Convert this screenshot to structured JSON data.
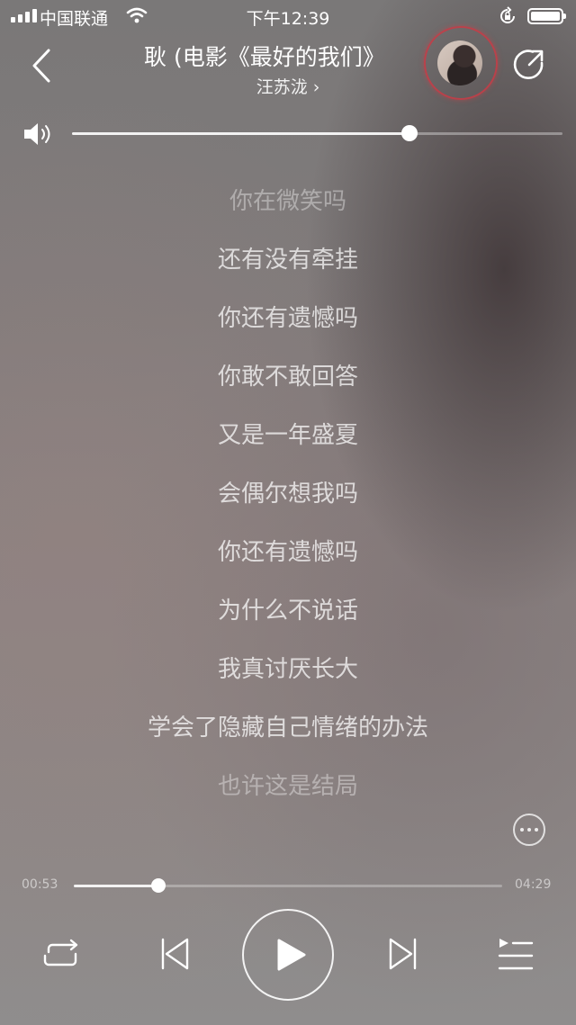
{
  "status_bar": {
    "carrier": "中国联通",
    "time": "下午12:39"
  },
  "header": {
    "title": "耿 (电影《最好的我们》",
    "artist": "汪苏泷",
    "artist_chevron": "›"
  },
  "volume": {
    "level": 0.688
  },
  "lyrics": [
    {
      "text": "你在微笑吗",
      "faded": true
    },
    {
      "text": "还有没有牵挂",
      "faded": false
    },
    {
      "text": "你还有遗憾吗",
      "faded": false
    },
    {
      "text": "你敢不敢回答",
      "faded": false
    },
    {
      "text": "又是一年盛夏",
      "faded": false
    },
    {
      "text": "会偶尔想我吗",
      "faded": false
    },
    {
      "text": "你还有遗憾吗",
      "faded": false
    },
    {
      "text": "为什么不说话",
      "faded": false
    },
    {
      "text": "我真讨厌长大",
      "faded": false
    },
    {
      "text": "学会了隐藏自己情绪的办法",
      "faded": false
    },
    {
      "text": "也许这是结局",
      "faded": true
    }
  ],
  "progress": {
    "current_time": "00:53",
    "total_time": "04:29",
    "fraction": 0.197
  },
  "controls": {
    "repeat": "repeat-icon",
    "previous": "previous-icon",
    "play": "play-icon",
    "next": "next-icon",
    "playlist": "playlist-icon"
  },
  "colors": {
    "accent_ring": "#c83c46",
    "text": "#ffffff"
  }
}
